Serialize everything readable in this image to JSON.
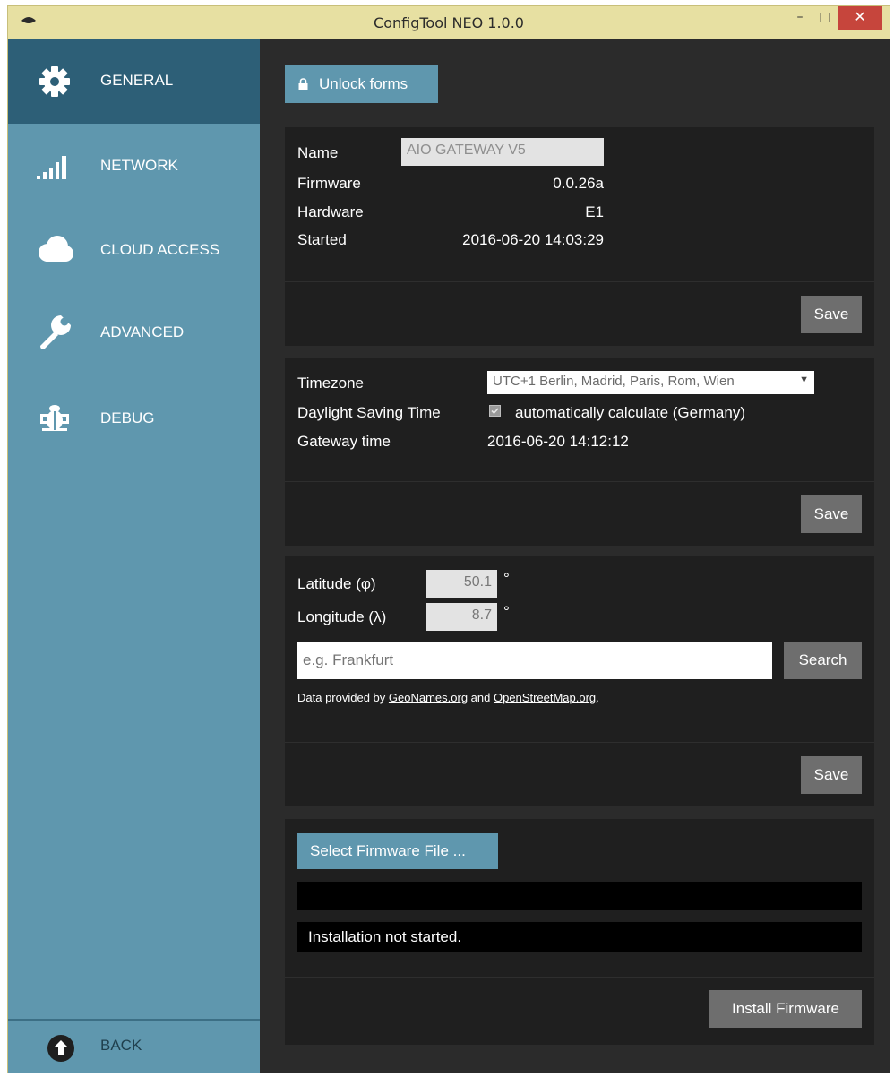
{
  "window": {
    "title": "ConfigTool NEO 1.0.0",
    "minimize": "–",
    "maximize": "□",
    "close": "✕"
  },
  "sidebar": {
    "items": [
      {
        "label": "GENERAL",
        "icon": "gear-icon"
      },
      {
        "label": "NETWORK",
        "icon": "signal-icon"
      },
      {
        "label": "CLOUD ACCESS",
        "icon": "cloud-icon"
      },
      {
        "label": "ADVANCED",
        "icon": "wrench-icon"
      },
      {
        "label": "DEBUG",
        "icon": "bug-icon"
      }
    ],
    "back_label": "BACK"
  },
  "main": {
    "unlock_label": "Unlock forms",
    "info": {
      "name_label": "Name",
      "name_value": "AIO GATEWAY V5",
      "firmware_label": "Firmware",
      "firmware_value": "0.0.26a",
      "hardware_label": "Hardware",
      "hardware_value": "E1",
      "started_label": "Started",
      "started_value": "2016-06-20 14:03:29",
      "save_label": "Save"
    },
    "time": {
      "timezone_label": "Timezone",
      "timezone_value": "UTC+1  Berlin, Madrid, Paris, Rom, Wien",
      "dst_label": "Daylight Saving Time",
      "dst_checkbox_label": "automatically calculate (Germany)",
      "gateway_time_label": "Gateway time",
      "gateway_time_value": "2016-06-20 14:12:12",
      "save_label": "Save"
    },
    "location": {
      "latitude_label": "Latitude (φ)",
      "latitude_value": "50.1",
      "degree": "°",
      "longitude_label": "Longitude (λ)",
      "longitude_value": "8.7",
      "search_placeholder": "e.g. Frankfurt",
      "search_label": "Search",
      "credit_prefix": "Data provided by ",
      "credit_link1": "GeoNames.org",
      "credit_mid": " and ",
      "credit_link2": "OpenStreetMap.org",
      "credit_suffix": ".",
      "save_label": "Save"
    },
    "firmware": {
      "select_label": "Select Firmware File ...",
      "file_path": "",
      "status": "Installation not started.",
      "install_label": "Install Firmware"
    }
  }
}
